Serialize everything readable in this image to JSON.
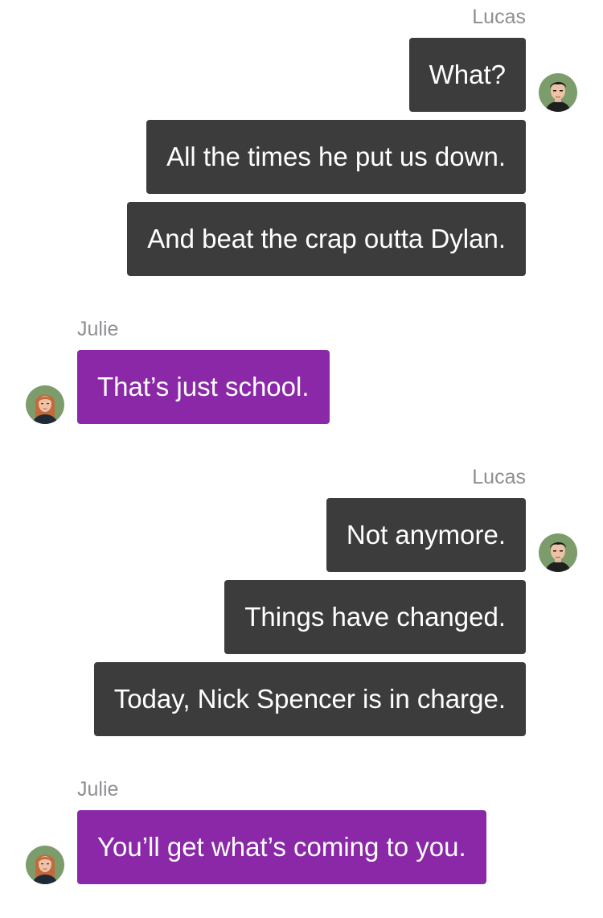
{
  "conversation": {
    "groups": [
      {
        "sender": "Lucas",
        "side": "right",
        "avatar": "lucas-avatar-icon",
        "messages": [
          "What?",
          "All the times he put us down.",
          "And beat the crap outta Dylan."
        ]
      },
      {
        "sender": "Julie",
        "side": "left",
        "avatar": "julie-avatar-icon",
        "messages": [
          "That’s just school."
        ]
      },
      {
        "sender": "Lucas",
        "side": "right",
        "avatar": "lucas-avatar-icon",
        "messages": [
          "Not anymore.",
          "Things have changed.",
          "Today, Nick Spencer is in charge."
        ]
      },
      {
        "sender": "Julie",
        "side": "left",
        "avatar": "julie-avatar-icon",
        "messages": [
          "You’ll get what’s coming to you."
        ]
      }
    ]
  },
  "colors": {
    "my_bubble": "#3c3c3c",
    "their_bubble": "#8a28a8",
    "sender_name": "#8e8e93",
    "background": "#ffffff"
  }
}
